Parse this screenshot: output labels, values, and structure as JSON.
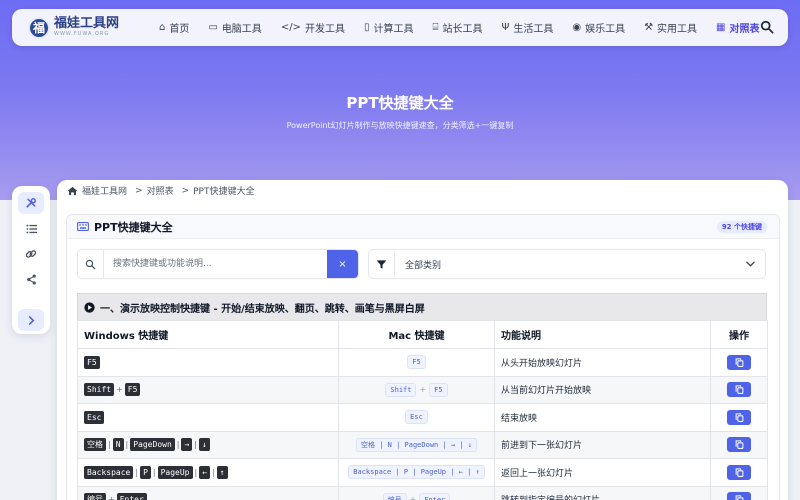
{
  "site": {
    "name": "福娃工具网",
    "url": "WWW.FUWA.ORG",
    "logo_char": "福"
  },
  "nav": {
    "items": [
      {
        "label": "首页",
        "icon": "home-icon",
        "glyph": "⌂"
      },
      {
        "label": "电脑工具",
        "icon": "desktop-icon",
        "glyph": "▭"
      },
      {
        "label": "开发工具",
        "icon": "code-icon",
        "glyph": "</>"
      },
      {
        "label": "计算工具",
        "icon": "calculator-icon",
        "glyph": "▯"
      },
      {
        "label": "站长工具",
        "icon": "toolbox-icon",
        "glyph": "⌸"
      },
      {
        "label": "生活工具",
        "icon": "utensils-icon",
        "glyph": "Ψ"
      },
      {
        "label": "娱乐工具",
        "icon": "gamepad-icon",
        "glyph": "◉"
      },
      {
        "label": "实用工具",
        "icon": "wrench-icon",
        "glyph": "⚒"
      },
      {
        "label": "对照表",
        "icon": "table-icon",
        "glyph": "▦"
      }
    ]
  },
  "hero": {
    "title": "PPT快捷键大全",
    "subtitle": "PowerPoint幻灯片制作与放映快捷键速查，分类筛选+一键复制"
  },
  "sidebar": {
    "buttons": [
      {
        "icon": "tools-icon"
      },
      {
        "icon": "list-icon"
      },
      {
        "icon": "link-icon"
      },
      {
        "icon": "share-icon"
      },
      {
        "icon": "chevron-right-icon"
      }
    ]
  },
  "breadcrumb": {
    "home": "福娃工具网",
    "sep1": ">",
    "level2": "对照表",
    "sep2": ">",
    "current": "PPT快捷键大全"
  },
  "card": {
    "title": "PPT快捷键大全",
    "count_badge": "92 个快捷键"
  },
  "search": {
    "placeholder": "搜索快捷键或功能说明...",
    "value": "",
    "clear_label": "×"
  },
  "filter": {
    "selected": "全部类别"
  },
  "section": {
    "title": "一、演示放映控制快捷键 - 开始/结束放映、翻页、跳转、画笔与黑屏白屏"
  },
  "table": {
    "headers": {
      "windows": "Windows 快捷键",
      "mac": "Mac 快捷键",
      "desc": "功能说明",
      "action": "操作"
    },
    "rows": [
      {
        "win": [
          [
            "F5"
          ]
        ],
        "mac": [
          "F5"
        ],
        "desc": "从头开始放映幻灯片"
      },
      {
        "win": [
          [
            "Shift",
            "F5"
          ]
        ],
        "mac": [
          "Shift",
          "F5"
        ],
        "desc": "从当前幻灯片开始放映"
      },
      {
        "win": [
          [
            "Esc"
          ]
        ],
        "mac": [
          "Esc"
        ],
        "desc": "结束放映"
      },
      {
        "win": [
          [
            "空格"
          ],
          [
            "N"
          ],
          [
            "PageDown"
          ],
          [
            "→"
          ],
          [
            "↓"
          ]
        ],
        "mac": [
          "空格 | N | PageDown | → | ↓"
        ],
        "desc": "前进到下一张幻灯片"
      },
      {
        "win": [
          [
            "Backspace"
          ],
          [
            "P"
          ],
          [
            "PageUp"
          ],
          [
            "←"
          ],
          [
            "↑"
          ]
        ],
        "mac": [
          "Backspace | P | PageUp | ← | ↑"
        ],
        "desc": "返回上一张幻灯片"
      },
      {
        "win": [
          [
            "编号",
            "Enter"
          ]
        ],
        "mac": [
          "编号",
          "Enter"
        ],
        "desc": "跳转到指定编号的幻灯片"
      }
    ]
  },
  "colors": {
    "accent": "#4f63e8",
    "hero_top": "#6d6cf5",
    "hero_bottom": "#a79cef",
    "active_nav": "#4f46e5"
  }
}
